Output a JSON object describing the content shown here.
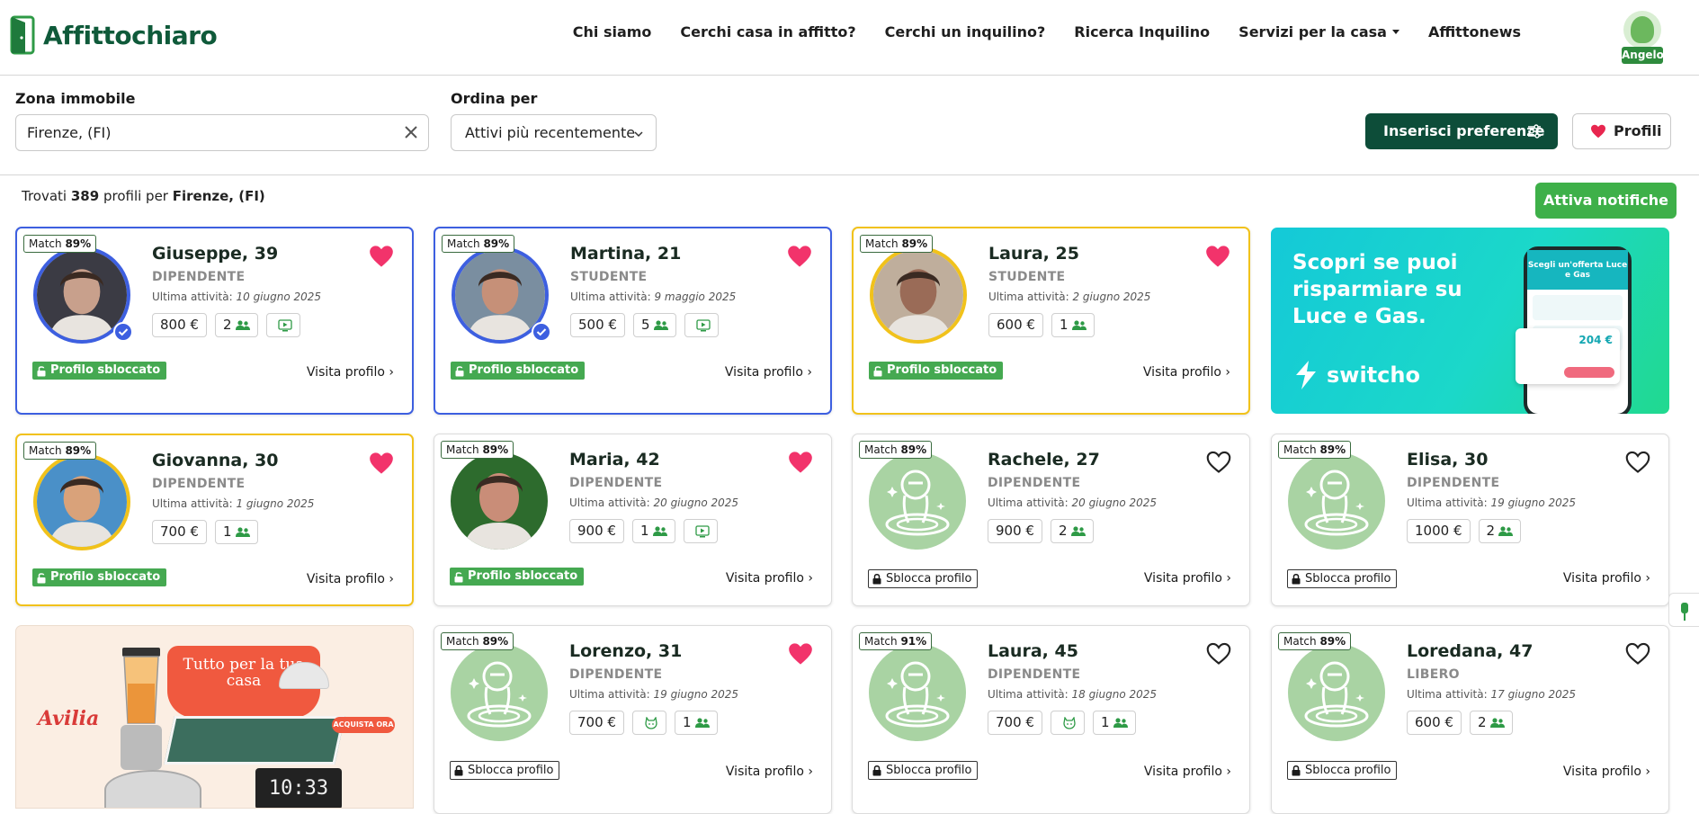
{
  "brand": {
    "name": "Affittochiaro"
  },
  "nav": {
    "links": [
      "Chi siamo",
      "Cerchi casa in affitto?",
      "Cerchi un inquilino?",
      "Ricerca Inquilino",
      "Servizi per la casa",
      "Affittonews"
    ],
    "user_name": "Angelo"
  },
  "filters": {
    "zone_label": "Zona immobile",
    "zone_value": "Firenze, (FI)",
    "sort_label": "Ordina per",
    "sort_value": "Attivi più recentemente",
    "pref_button": "Inserisci preferenze",
    "profiles_button": "Profili"
  },
  "results": {
    "prefix": "Trovati",
    "count": "389",
    "middle": "profili per",
    "place": "Firenze, (FI)",
    "notify_button": "Attiva notifiche"
  },
  "labels": {
    "match": "Match",
    "last_activity": "Ultima attività:",
    "unlocked": "Profilo sbloccato",
    "locked": "Sblocca profilo",
    "visit": "Visita profilo ›"
  },
  "profiles": [
    {
      "name": "Giuseppe, 39",
      "job": "DIPENDENTE",
      "date": "10 giugno 2025",
      "match": "89%",
      "price": "800 €",
      "people": "2",
      "video": true,
      "pet": false,
      "liked": true,
      "status": "unlocked",
      "verified": true,
      "style": "blue",
      "photo": "photo"
    },
    {
      "name": "Martina, 21",
      "job": "STUDENTE",
      "date": "9 maggio 2025",
      "match": "89%",
      "price": "500 €",
      "people": "5",
      "video": true,
      "pet": false,
      "liked": true,
      "status": "unlocked",
      "verified": true,
      "style": "blue",
      "photo": "photo"
    },
    {
      "name": "Laura, 25",
      "job": "STUDENTE",
      "date": "2 giugno 2025",
      "match": "89%",
      "price": "600 €",
      "people": "1",
      "video": false,
      "pet": false,
      "liked": true,
      "status": "unlocked",
      "verified": false,
      "style": "gold",
      "photo": "photo"
    },
    {
      "name": "Giovanna, 30",
      "job": "DIPENDENTE",
      "date": "1 giugno 2025",
      "match": "89%",
      "price": "700 €",
      "people": "1",
      "video": false,
      "pet": false,
      "liked": true,
      "status": "unlocked",
      "verified": false,
      "style": "gold",
      "photo": "photo"
    },
    {
      "name": "Maria, 42",
      "job": "DIPENDENTE",
      "date": "20 giugno 2025",
      "match": "89%",
      "price": "900 €",
      "people": "1",
      "video": true,
      "pet": false,
      "liked": true,
      "status": "unlocked",
      "verified": false,
      "style": "plain",
      "photo": "photo"
    },
    {
      "name": "Rachele, 27",
      "job": "DIPENDENTE",
      "date": "20 giugno 2025",
      "match": "89%",
      "price": "900 €",
      "people": "2",
      "video": false,
      "pet": false,
      "liked": false,
      "status": "locked",
      "verified": false,
      "style": "plain",
      "photo": "astronaut"
    },
    {
      "name": "Elisa, 30",
      "job": "DIPENDENTE",
      "date": "19 giugno 2025",
      "match": "89%",
      "price": "1000 €",
      "people": "2",
      "video": false,
      "pet": false,
      "liked": false,
      "status": "locked",
      "verified": false,
      "style": "plain",
      "photo": "astronaut"
    },
    {
      "name": "Lorenzo, 31",
      "job": "DIPENDENTE",
      "date": "19 giugno 2025",
      "match": "89%",
      "price": "700 €",
      "people": "1",
      "video": false,
      "pet": true,
      "liked": true,
      "status": "locked",
      "verified": false,
      "style": "plain",
      "photo": "astronaut"
    },
    {
      "name": "Laura, 45",
      "job": "DIPENDENTE",
      "date": "18 giugno 2025",
      "match": "91%",
      "price": "700 €",
      "people": "1",
      "video": false,
      "pet": true,
      "liked": false,
      "status": "locked",
      "verified": false,
      "style": "plain",
      "photo": "astronaut"
    },
    {
      "name": "Loredana, 47",
      "job": "LIBERO",
      "date": "17 giugno 2025",
      "match": "89%",
      "price": "600 €",
      "people": "2",
      "video": false,
      "pet": false,
      "liked": false,
      "status": "locked",
      "verified": false,
      "style": "plain",
      "photo": "astronaut"
    }
  ],
  "ads": {
    "switcho": {
      "headline": "Scopri se puoi risparmiare su Luce e Gas.",
      "brand": "switcho",
      "phone_title": "Scegli un'offerta Luce e Gas",
      "price": "204 €"
    },
    "avilia": {
      "brand": "Avilia",
      "headline": "Tutto per la tua casa",
      "cta": "ACQUISTA ORA",
      "clock": "10:33"
    }
  },
  "colors": {
    "brand_dark": "#0d4d39",
    "green": "#3eb049",
    "heart": "#f2336b",
    "blue_ring": "#3d5fe0",
    "gold_ring": "#f1c21b"
  }
}
